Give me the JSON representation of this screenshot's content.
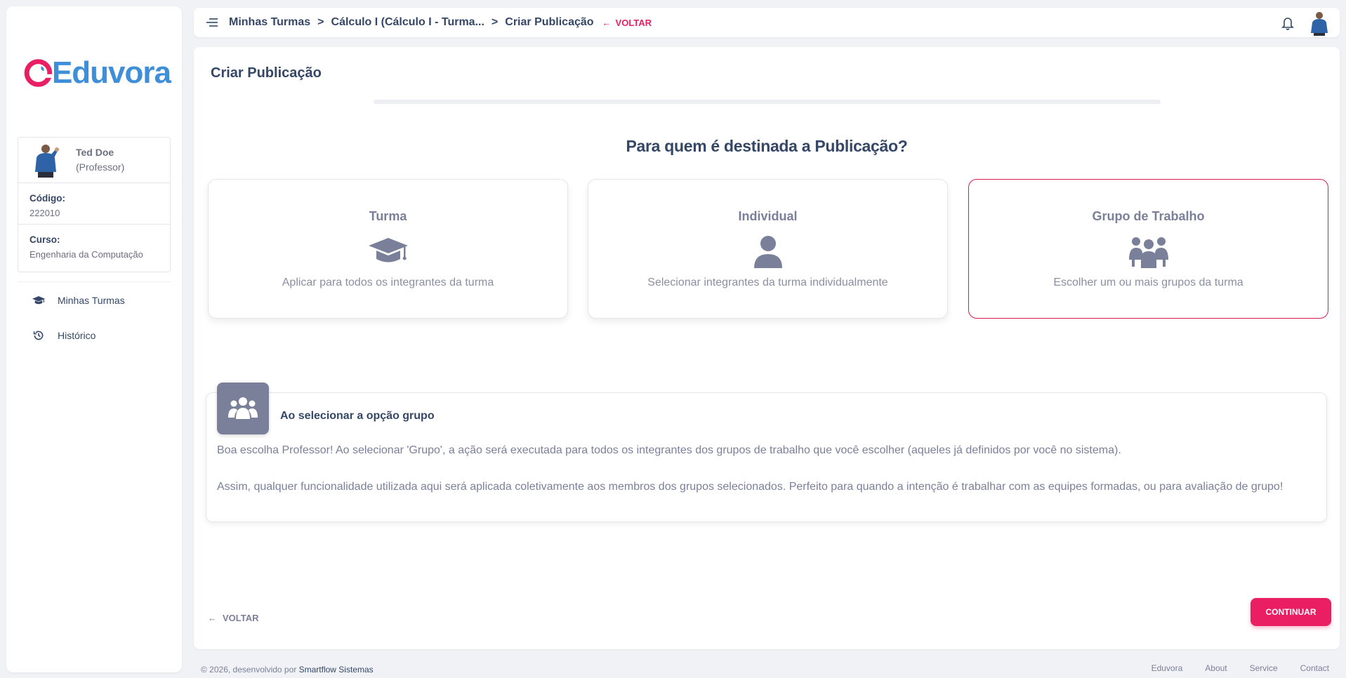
{
  "brand": {
    "name": "Eduvora",
    "primary_color": "#e91e63",
    "logo_color": "#3f8fd8"
  },
  "user": {
    "name": "Ted Doe",
    "role": "(Professor)",
    "code_label": "Código:",
    "code_value": "222010",
    "course_label": "Curso:",
    "course_value": "Engenharia da Computação"
  },
  "sidebar": {
    "items": [
      {
        "label": "Minhas Turmas",
        "icon": "graduation-cap-icon"
      },
      {
        "label": "Histórico",
        "icon": "history-icon"
      }
    ]
  },
  "topbar": {
    "breadcrumbs": [
      "Minhas Turmas",
      "Cálculo I (Cálculo I - Turma...",
      "Criar Publicação"
    ],
    "separator": ">",
    "back_label": "VOLTAR"
  },
  "main": {
    "title": "Criar Publicação",
    "question": "Para quem é destinada a Publicação?",
    "options": [
      {
        "title": "Turma",
        "description": "Aplicar para todos os integrantes da turma",
        "icon": "graduation-cap-icon",
        "selected": false
      },
      {
        "title": "Individual",
        "description": "Selecionar integrantes da turma individualmente",
        "icon": "user-icon",
        "selected": false
      },
      {
        "title": "Grupo de Trabalho",
        "description": "Escolher um ou mais grupos da turma",
        "icon": "users-group-icon",
        "selected": true
      }
    ],
    "info": {
      "title": "Ao selecionar a opção grupo",
      "paragraph_1": "Boa escolha Professor! Ao selecionar 'Grupo', a ação será executada para todos os integrantes dos grupos de trabalho que você escolher (aqueles já definidos por você no sistema).",
      "paragraph_2": "Assim, qualquer funcionalidade utilizada aqui será aplicada coletivamente aos membros dos grupos selecionados. Perfeito para quando a intenção é trabalhar com as equipes formadas, ou para avaliação de grupo!"
    },
    "back_label": "VOLTAR",
    "continue_label": "CONTINUAR"
  },
  "footer": {
    "copyright": "© 2026, desenvolvido por ",
    "company": "Smartflow Sistemas",
    "links": [
      "Eduvora",
      "About",
      "Service",
      "Contact"
    ]
  }
}
